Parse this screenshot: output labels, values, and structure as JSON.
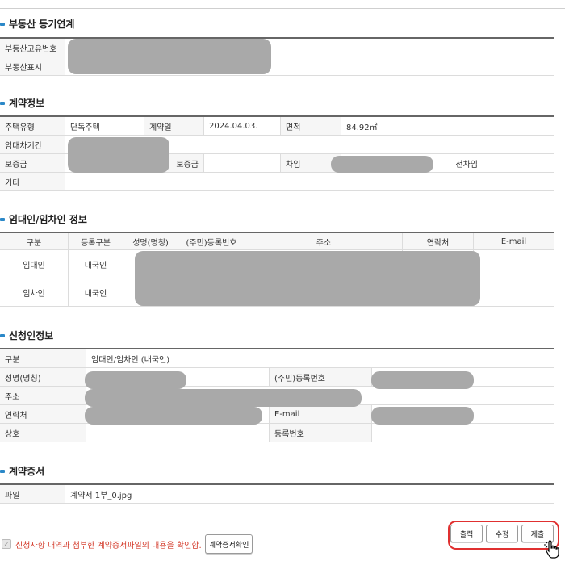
{
  "sections": {
    "registry": {
      "title": "부동산 등기연계",
      "rows": [
        {
          "label": "부동산고유번호"
        },
        {
          "label": "부동산표시"
        }
      ]
    },
    "contract": {
      "title": "계약정보",
      "row1": {
        "type_label": "주택유형",
        "type_value": "단독주택",
        "date_label": "계약일",
        "date_value": "2024.04.03.",
        "area_label": "면적",
        "area_value": "84.92㎡"
      },
      "row2": {
        "period_label": "임대차기간"
      },
      "row3": {
        "deposit_label": "보증금",
        "deposit2_label": "보증금",
        "rent_label": "차임",
        "rent2_label": "전차임"
      },
      "row4": {
        "etc_label": "기타"
      }
    },
    "parties": {
      "title": "임대인/임차인 정보",
      "headers": [
        "구분",
        "등록구분",
        "성명(명칭)",
        "(주민)등록번호",
        "주소",
        "연락처",
        "E-mail"
      ],
      "rows": [
        {
          "type": "임대인",
          "reg": "내국인"
        },
        {
          "type": "임차인",
          "reg": "내국인"
        }
      ]
    },
    "applicant": {
      "title": "신청인정보",
      "category_label": "구분",
      "category_value": "임대인/임차인 (내국인)",
      "name_label": "성명(명칭)",
      "regno_label": "(주민)등록번호",
      "address_label": "주소",
      "contact_label": "연락처",
      "email_label": "E-mail",
      "company_label": "상호",
      "bizno_label": "등록번호"
    },
    "certificate": {
      "title": "계약증서",
      "file_label": "파일",
      "file_value": "계약서 1부_0.jpg"
    }
  },
  "footer": {
    "confirm_text": "신청사항 내역과 첨부한 계약증서파일의 내용을 확인함.",
    "view_cert_button": "계약증서확인",
    "print_button": "출력",
    "edit_button": "수정",
    "submit_button": "제출"
  },
  "colors": {
    "accent": "#2b88c8",
    "highlight": "#e03030",
    "redaction": "#a9a9a9",
    "confirm_text": "#d43c2c"
  }
}
